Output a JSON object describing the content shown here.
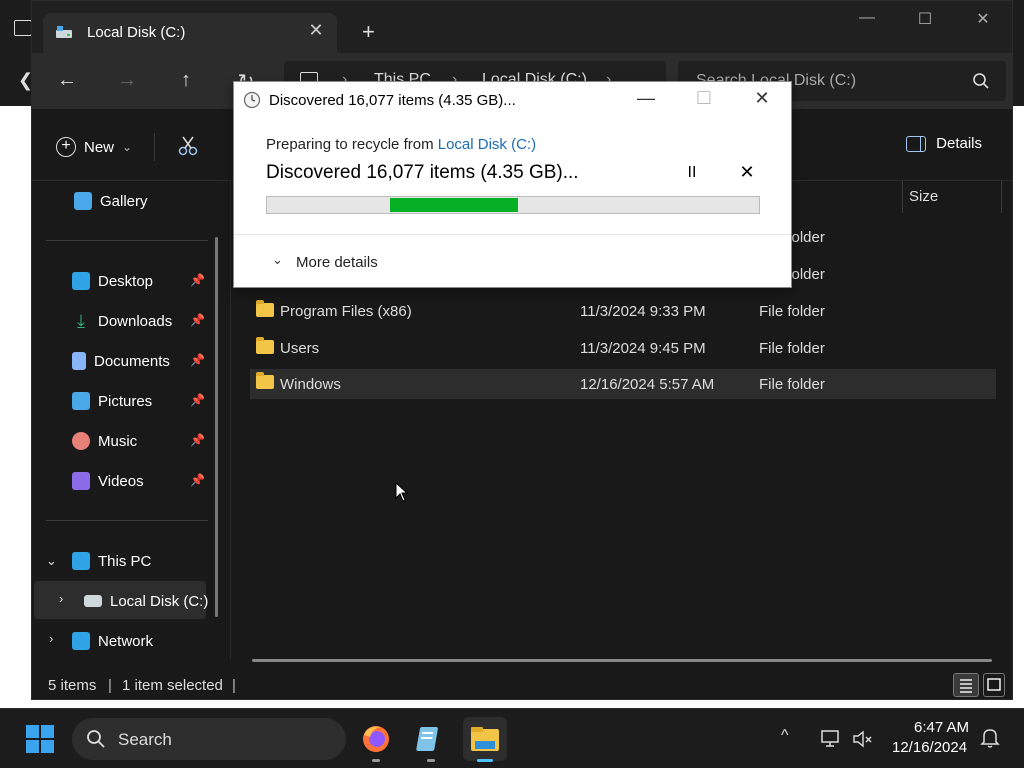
{
  "explorer": {
    "tab_title": "Local Disk (C:)",
    "new_tab_glyph": "+",
    "tab_close_glyph": "✕",
    "window_controls": {
      "minimize": "—",
      "maximize": "☐",
      "close": "✕"
    },
    "address": {
      "segments": [
        "This PC",
        "Local Disk (C:)"
      ]
    },
    "search_placeholder": "Search Local Disk (C:)",
    "toolbar": {
      "new_label": "New",
      "new_chevron": "⌄",
      "details_label": "Details"
    },
    "sidebar": {
      "gallery": "Gallery",
      "quick_access": [
        {
          "label": "Desktop",
          "icon": "desktop-icon",
          "color": "#2fa3e6"
        },
        {
          "label": "Downloads",
          "icon": "download-icon",
          "color": "#36b37e"
        },
        {
          "label": "Documents",
          "icon": "document-icon",
          "color": "#8ab4f8"
        },
        {
          "label": "Pictures",
          "icon": "picture-icon",
          "color": "#4aa8e8"
        },
        {
          "label": "Music",
          "icon": "music-icon",
          "color": "#e8807a"
        },
        {
          "label": "Videos",
          "icon": "video-icon",
          "color": "#8c6be8"
        }
      ],
      "this_pc": "This PC",
      "local_disk": "Local Disk (C:)",
      "network": "Network"
    },
    "columns": {
      "size": "Size"
    },
    "files": [
      {
        "name": "Program Files (x86)",
        "date": "11/3/2024 9:33 PM",
        "type": "File folder"
      },
      {
        "name": "Users",
        "date": "11/3/2024 9:45 PM",
        "type": "File folder"
      },
      {
        "name": "Windows",
        "date": "12/16/2024 5:57 AM",
        "type": "File folder",
        "selected": true
      }
    ],
    "status": {
      "items": "5 items",
      "selected": "1 item selected"
    }
  },
  "dialog": {
    "title": "Discovered 16,077 items (4.35 GB)...",
    "subtitle_prefix": "Preparing to recycle from ",
    "subtitle_link": "Local Disk (C:)",
    "main_text": "Discovered 16,077 items (4.35 GB)...",
    "pause_glyph": "II",
    "cancel_glyph": "✕",
    "progress": {
      "start_fraction": 0.25,
      "end_fraction": 0.51
    },
    "more_details": "More details",
    "more_chevron": "⌄",
    "controls": {
      "minimize": "—",
      "maximize": "☐",
      "close": "✕"
    }
  },
  "taskbar": {
    "search_label": "Search",
    "apps": [
      "firefox-icon",
      "notepad-icon",
      "file-explorer-icon"
    ],
    "time": "6:47 AM",
    "date": "12/16/2024",
    "tray_chevron": "^"
  },
  "colors": {
    "accent": "#0078d4",
    "progress_green": "#06b025",
    "folder_yellow": "#f3c547"
  }
}
